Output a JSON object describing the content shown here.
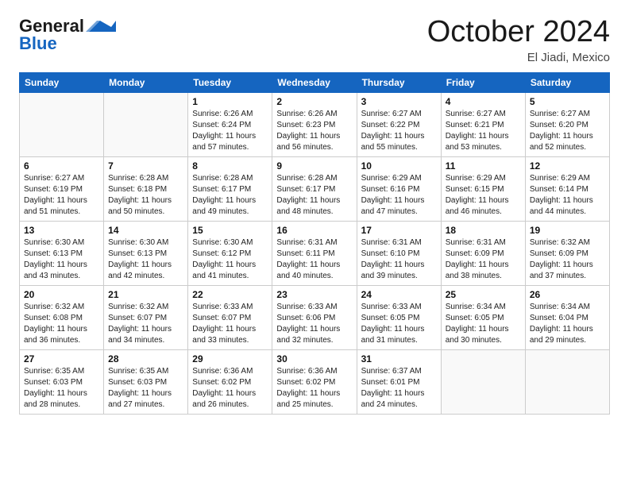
{
  "header": {
    "logo_line1": "General",
    "logo_line2": "Blue",
    "month_title": "October 2024",
    "location": "El Jiadi, Mexico"
  },
  "weekdays": [
    "Sunday",
    "Monday",
    "Tuesday",
    "Wednesday",
    "Thursday",
    "Friday",
    "Saturday"
  ],
  "weeks": [
    [
      {
        "day": "",
        "info": ""
      },
      {
        "day": "",
        "info": ""
      },
      {
        "day": "1",
        "info": "Sunrise: 6:26 AM\nSunset: 6:24 PM\nDaylight: 11 hours and 57 minutes."
      },
      {
        "day": "2",
        "info": "Sunrise: 6:26 AM\nSunset: 6:23 PM\nDaylight: 11 hours and 56 minutes."
      },
      {
        "day": "3",
        "info": "Sunrise: 6:27 AM\nSunset: 6:22 PM\nDaylight: 11 hours and 55 minutes."
      },
      {
        "day": "4",
        "info": "Sunrise: 6:27 AM\nSunset: 6:21 PM\nDaylight: 11 hours and 53 minutes."
      },
      {
        "day": "5",
        "info": "Sunrise: 6:27 AM\nSunset: 6:20 PM\nDaylight: 11 hours and 52 minutes."
      }
    ],
    [
      {
        "day": "6",
        "info": "Sunrise: 6:27 AM\nSunset: 6:19 PM\nDaylight: 11 hours and 51 minutes."
      },
      {
        "day": "7",
        "info": "Sunrise: 6:28 AM\nSunset: 6:18 PM\nDaylight: 11 hours and 50 minutes."
      },
      {
        "day": "8",
        "info": "Sunrise: 6:28 AM\nSunset: 6:17 PM\nDaylight: 11 hours and 49 minutes."
      },
      {
        "day": "9",
        "info": "Sunrise: 6:28 AM\nSunset: 6:17 PM\nDaylight: 11 hours and 48 minutes."
      },
      {
        "day": "10",
        "info": "Sunrise: 6:29 AM\nSunset: 6:16 PM\nDaylight: 11 hours and 47 minutes."
      },
      {
        "day": "11",
        "info": "Sunrise: 6:29 AM\nSunset: 6:15 PM\nDaylight: 11 hours and 46 minutes."
      },
      {
        "day": "12",
        "info": "Sunrise: 6:29 AM\nSunset: 6:14 PM\nDaylight: 11 hours and 44 minutes."
      }
    ],
    [
      {
        "day": "13",
        "info": "Sunrise: 6:30 AM\nSunset: 6:13 PM\nDaylight: 11 hours and 43 minutes."
      },
      {
        "day": "14",
        "info": "Sunrise: 6:30 AM\nSunset: 6:13 PM\nDaylight: 11 hours and 42 minutes."
      },
      {
        "day": "15",
        "info": "Sunrise: 6:30 AM\nSunset: 6:12 PM\nDaylight: 11 hours and 41 minutes."
      },
      {
        "day": "16",
        "info": "Sunrise: 6:31 AM\nSunset: 6:11 PM\nDaylight: 11 hours and 40 minutes."
      },
      {
        "day": "17",
        "info": "Sunrise: 6:31 AM\nSunset: 6:10 PM\nDaylight: 11 hours and 39 minutes."
      },
      {
        "day": "18",
        "info": "Sunrise: 6:31 AM\nSunset: 6:09 PM\nDaylight: 11 hours and 38 minutes."
      },
      {
        "day": "19",
        "info": "Sunrise: 6:32 AM\nSunset: 6:09 PM\nDaylight: 11 hours and 37 minutes."
      }
    ],
    [
      {
        "day": "20",
        "info": "Sunrise: 6:32 AM\nSunset: 6:08 PM\nDaylight: 11 hours and 36 minutes."
      },
      {
        "day": "21",
        "info": "Sunrise: 6:32 AM\nSunset: 6:07 PM\nDaylight: 11 hours and 34 minutes."
      },
      {
        "day": "22",
        "info": "Sunrise: 6:33 AM\nSunset: 6:07 PM\nDaylight: 11 hours and 33 minutes."
      },
      {
        "day": "23",
        "info": "Sunrise: 6:33 AM\nSunset: 6:06 PM\nDaylight: 11 hours and 32 minutes."
      },
      {
        "day": "24",
        "info": "Sunrise: 6:33 AM\nSunset: 6:05 PM\nDaylight: 11 hours and 31 minutes."
      },
      {
        "day": "25",
        "info": "Sunrise: 6:34 AM\nSunset: 6:05 PM\nDaylight: 11 hours and 30 minutes."
      },
      {
        "day": "26",
        "info": "Sunrise: 6:34 AM\nSunset: 6:04 PM\nDaylight: 11 hours and 29 minutes."
      }
    ],
    [
      {
        "day": "27",
        "info": "Sunrise: 6:35 AM\nSunset: 6:03 PM\nDaylight: 11 hours and 28 minutes."
      },
      {
        "day": "28",
        "info": "Sunrise: 6:35 AM\nSunset: 6:03 PM\nDaylight: 11 hours and 27 minutes."
      },
      {
        "day": "29",
        "info": "Sunrise: 6:36 AM\nSunset: 6:02 PM\nDaylight: 11 hours and 26 minutes."
      },
      {
        "day": "30",
        "info": "Sunrise: 6:36 AM\nSunset: 6:02 PM\nDaylight: 11 hours and 25 minutes."
      },
      {
        "day": "31",
        "info": "Sunrise: 6:37 AM\nSunset: 6:01 PM\nDaylight: 11 hours and 24 minutes."
      },
      {
        "day": "",
        "info": ""
      },
      {
        "day": "",
        "info": ""
      }
    ]
  ]
}
